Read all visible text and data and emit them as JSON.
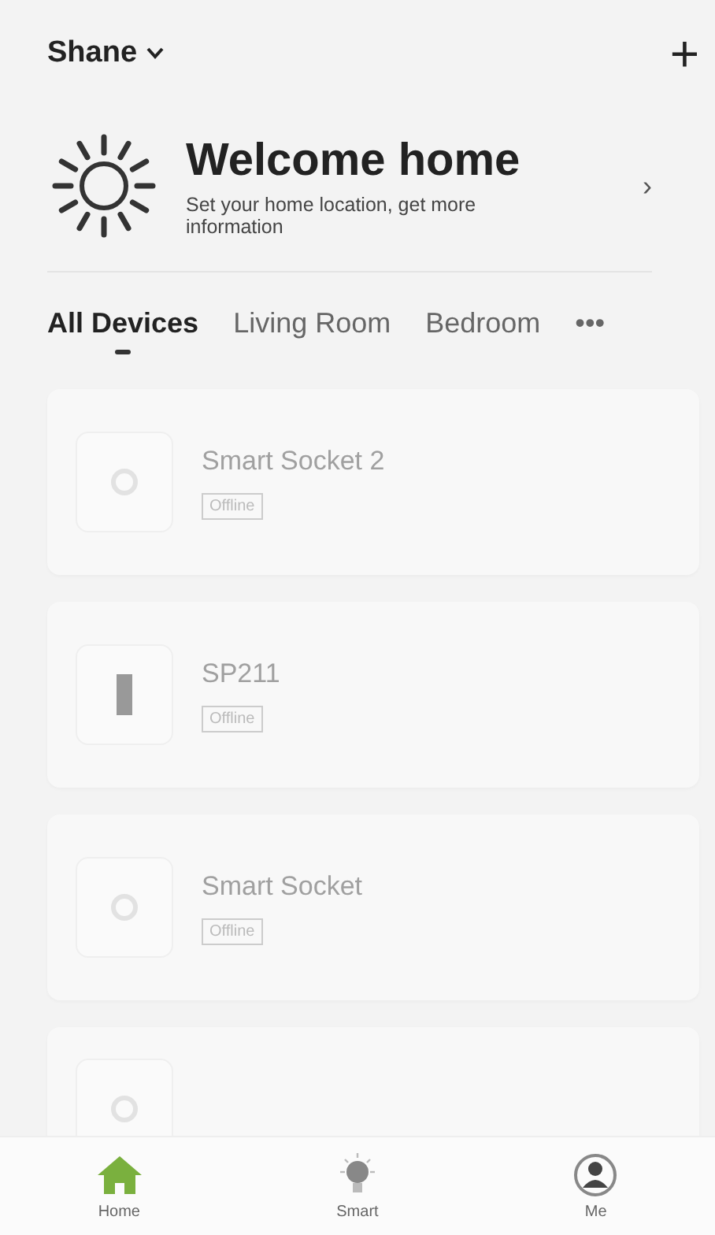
{
  "header": {
    "home_name": "Shane",
    "add_icon": "+"
  },
  "welcome": {
    "title": "Welcome home",
    "subtitle": "Set your home location, get more information",
    "chevron": "›"
  },
  "tabs": [
    {
      "label": "All Devices",
      "selected": true
    },
    {
      "label": "Living Room",
      "selected": false
    },
    {
      "label": "Bedroom",
      "selected": false
    },
    {
      "label": "•••",
      "selected": false
    }
  ],
  "devices": [
    {
      "name": "Smart Socket 2",
      "status": "Offline",
      "kind": "socket"
    },
    {
      "name": "SP211",
      "status": "Offline",
      "kind": "plug"
    },
    {
      "name": "Smart Socket",
      "status": "Offline",
      "kind": "socket"
    },
    {
      "kind": "socket"
    }
  ],
  "nav": [
    {
      "label": "Home",
      "kind": "home",
      "selected": true
    },
    {
      "label": "Smart",
      "kind": "smart",
      "selected": false
    },
    {
      "label": "Me",
      "kind": "me",
      "selected": false
    }
  ]
}
